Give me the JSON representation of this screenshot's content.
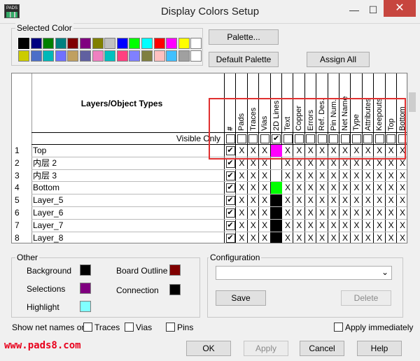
{
  "window": {
    "title": "Display Colors Setup",
    "icon_text": "PADS",
    "minimize_glyph": "—",
    "maximize_glyph": "☐",
    "close_glyph": "✕"
  },
  "selected_color": {
    "label": "Selected Color",
    "row1": [
      "#000000",
      "#000080",
      "#008000",
      "#008080",
      "#800000",
      "#800080",
      "#808000",
      "#c0c0c0",
      "#0000ff",
      "#00ff00",
      "#00ffff",
      "#ff0000",
      "#ff00ff",
      "#ffff00",
      "#ffffff"
    ],
    "row2": [
      "#cccc00",
      "#4b6ec8",
      "#00b8b8",
      "#7070ff",
      "#c0a060",
      "#6060a0",
      "#f080c0",
      "#00c0c0",
      "#ff4080",
      "#8080ff",
      "#808040",
      "#ffc0c0",
      "#40c0ff",
      "#a0a0a0",
      "#ffffff"
    ]
  },
  "buttons": {
    "palette": "Palette...",
    "default_palette": "Default Palette",
    "assign_all": "Assign All",
    "save": "Save",
    "delete": "Delete",
    "ok": "OK",
    "apply": "Apply",
    "cancel": "Cancel",
    "help": "Help"
  },
  "grid": {
    "layers_header": "Layers/Object Types",
    "visible_only": "Visible Only",
    "columns": [
      "#",
      "Pads",
      "Traces",
      "Vias",
      "2D Lines",
      "Text",
      "Copper",
      "Errors",
      "Ref. Des.",
      "Pin Num.",
      "Net Name",
      "Type",
      "Attributes",
      "Keepouts",
      "Top",
      "Bottom"
    ],
    "visible_checked": [
      false,
      false,
      false,
      false,
      true,
      false,
      false,
      false,
      false,
      false,
      false,
      false,
      false,
      false,
      false,
      false
    ],
    "cell_mark": "X",
    "check_mark": "✔",
    "rows": [
      {
        "num": "1",
        "name": "Top",
        "color": "#ff00ff"
      },
      {
        "num": "2",
        "name": "内层 2",
        "color": ""
      },
      {
        "num": "3",
        "name": "内层 3",
        "color": ""
      },
      {
        "num": "4",
        "name": "Bottom",
        "color": "#00ff00"
      },
      {
        "num": "5",
        "name": "Layer_5",
        "color": "#000000"
      },
      {
        "num": "6",
        "name": "Layer_6",
        "color": "#000000"
      },
      {
        "num": "7",
        "name": "Layer_7",
        "color": "#000000"
      },
      {
        "num": "8",
        "name": "Layer_8",
        "color": "#000000"
      }
    ]
  },
  "other": {
    "label": "Other",
    "background": {
      "label": "Background",
      "color": "#000000"
    },
    "selections": {
      "label": "Selections",
      "color": "#800080"
    },
    "highlight": {
      "label": "Highlight",
      "color": "#80ffff"
    },
    "board_outline": {
      "label": "Board Outline",
      "color": "#800000"
    },
    "connection": {
      "label": "Connection",
      "color": "#000000"
    }
  },
  "configuration": {
    "label": "Configuration",
    "value": "",
    "arrow": "⌄"
  },
  "net_names": {
    "label": "Show net names on",
    "traces": "Traces",
    "vias": "Vias",
    "pins": "Pins",
    "apply_immediately": "Apply immediately"
  },
  "watermark": "www.pads8.com"
}
